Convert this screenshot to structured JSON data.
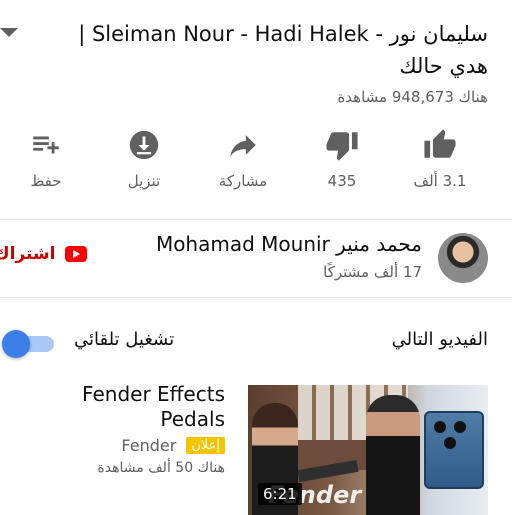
{
  "video": {
    "title": "سليمان نور - Sleiman Nour - Hadi Halek | هدي حالك",
    "views": "هناك 948,673 مشاهدة"
  },
  "actions": {
    "like_count": "3.1 ألف",
    "dislike_count": "435",
    "share_label": "مشاركة",
    "download_label": "تنزيل",
    "save_label": "حفظ"
  },
  "channel": {
    "name": "محمد منير Mohamad Mounir",
    "subscribers": "17 ألف مشتركًا",
    "subscribe_label": "اشتراك"
  },
  "up_next": {
    "label": "الفيديو التالي",
    "autoplay_label": "تشغيل تلقائي",
    "autoplay_on": true
  },
  "next_video": {
    "title": "Fender Effects Pedals",
    "ad_badge": "إعلان",
    "channel": "Fender",
    "views": "هناك 50 ألف مشاهدة",
    "duration": "6:21",
    "thumb_text": "Fender"
  },
  "colors": {
    "accent_blue": "#3b7ee8",
    "subscribe_red": "#cc0000",
    "ad_yellow": "#f5c400"
  }
}
